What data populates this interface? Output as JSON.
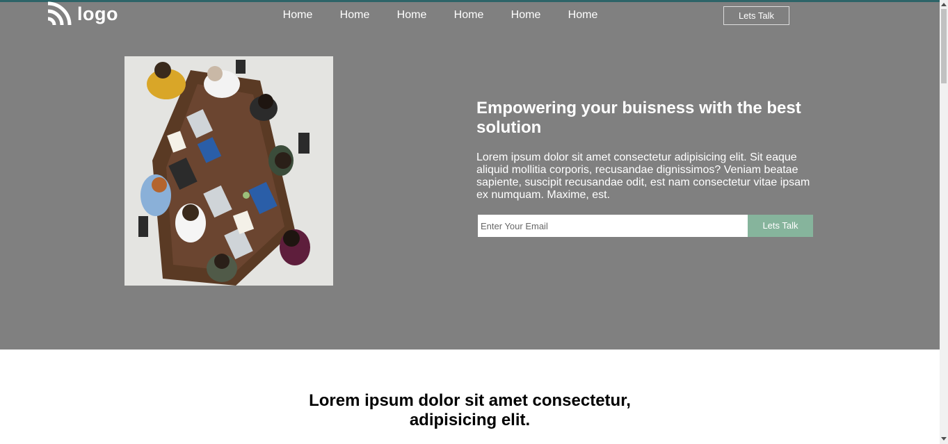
{
  "header": {
    "logo_text": "logo",
    "logo_icon": "signal-arcs-icon",
    "nav": [
      {
        "label": "Home"
      },
      {
        "label": "Home"
      },
      {
        "label": "Home"
      },
      {
        "label": "Home"
      },
      {
        "label": "Home"
      },
      {
        "label": "Home"
      }
    ],
    "cta_label": "Lets Talk"
  },
  "hero": {
    "title": "Empowering your buisness with the best solution",
    "text": "Lorem ipsum dolor sit amet consectetur adipisicing elit. Sit eaque aliquid mollitia corporis, recusandae dignissimos? Veniam beatae sapiente, suscipit recusandae odit, est nam consectetur vitae ipsam ex numquam. Maxime, est.",
    "email_placeholder": "Enter Your Email",
    "email_value": "",
    "submit_label": "Lets Talk"
  },
  "section": {
    "title": "Lorem ipsum dolor sit amet consectetur, adipisicing elit."
  },
  "colors": {
    "hero_bg": "#808080",
    "accent_button": "#86b49c",
    "top_border": "#2d6468"
  }
}
